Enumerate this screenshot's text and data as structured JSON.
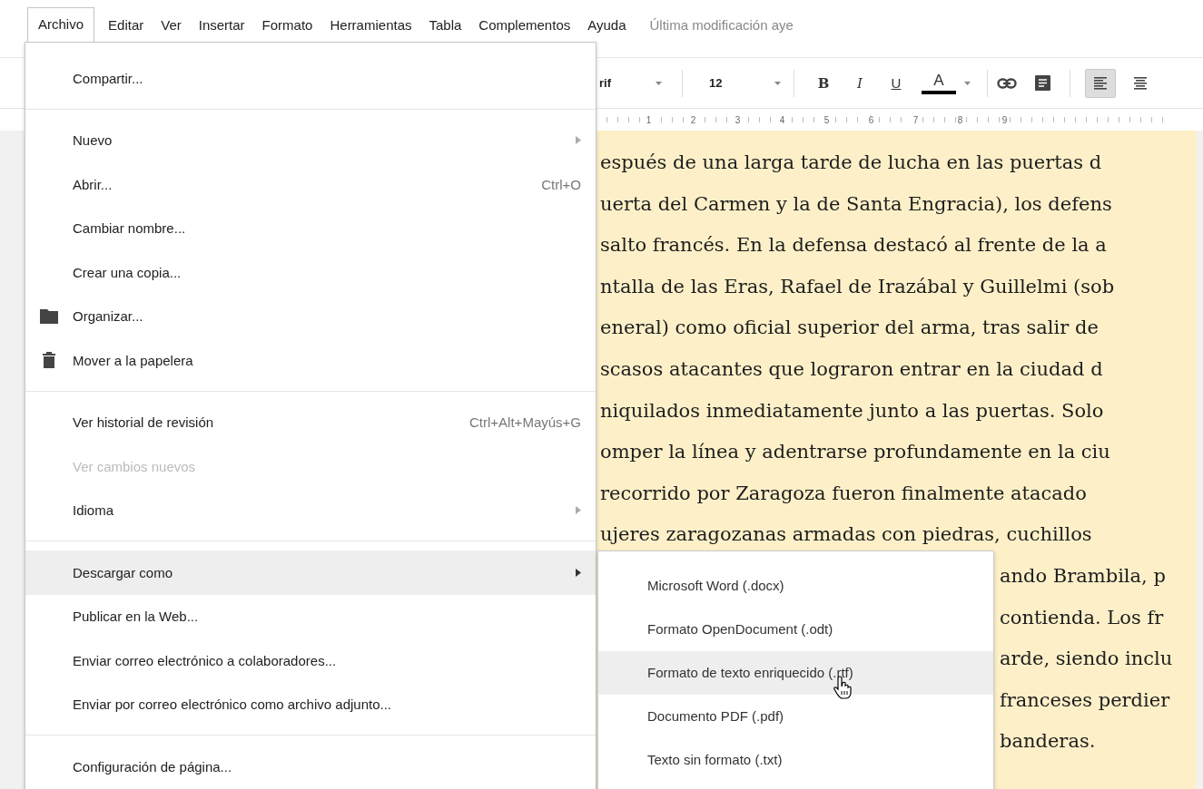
{
  "menubar": {
    "items": [
      {
        "label": "Archivo",
        "selected": true
      },
      {
        "label": "Editar",
        "selected": false
      },
      {
        "label": "Ver",
        "selected": false
      },
      {
        "label": "Insertar",
        "selected": false
      },
      {
        "label": "Formato",
        "selected": false
      },
      {
        "label": "Herramientas",
        "selected": false
      },
      {
        "label": "Tabla",
        "selected": false
      },
      {
        "label": "Complementos",
        "selected": false
      },
      {
        "label": "Ayuda",
        "selected": false
      }
    ],
    "last_modified": "Última modificación aye"
  },
  "toolbar": {
    "font_name": "rif",
    "font_size": "12",
    "format_buttons": [
      {
        "kind": "bold",
        "label": "B"
      },
      {
        "kind": "italic",
        "label": "I"
      },
      {
        "kind": "underline",
        "label": "U"
      },
      {
        "kind": "color",
        "label": "A"
      }
    ],
    "align_buttons": [
      {
        "kind": "left",
        "selected": true
      },
      {
        "kind": "center",
        "selected": false
      }
    ]
  },
  "ruler": {
    "numbers": [
      "1",
      "2",
      "3",
      "4",
      "5",
      "6",
      "7",
      "8",
      "9"
    ]
  },
  "document": {
    "lines": [
      "espués de una larga tarde de lucha en las puertas d",
      "uerta del Carmen y la de Santa Engracia), los defens",
      "salto francés. En la defensa destacó al frente de la a",
      "ntalla de las Eras, Rafael de Irazábal y Guillelmi (sob",
      "eneral) como oficial superior del arma, tras salir de",
      "scasos atacantes que lograron entrar en la ciudad d",
      "niquilados inmediatamente junto a las puertas. Solo",
      "omper la línea y adentrarse profundamente en la ciu",
      "recorrido por Zaragoza fueron finalmente atacado",
      "ujeres zaragozanas armadas con piedras, cuchillos",
      "ando Brambila, p",
      "contienda. Los fr",
      "arde, siendo inclu",
      "franceses perdier",
      "banderas."
    ]
  },
  "file_menu": {
    "items": [
      {
        "kind": "item",
        "label": "Compartir...",
        "selected": false,
        "disabled": false
      },
      {
        "kind": "separator"
      },
      {
        "kind": "item",
        "label": "Nuevo",
        "has_submenu": true,
        "selected": false,
        "disabled": false
      },
      {
        "kind": "item",
        "label": "Abrir...",
        "shortcut": "Ctrl+O",
        "selected": false,
        "disabled": false
      },
      {
        "kind": "item",
        "label": "Cambiar nombre...",
        "selected": false,
        "disabled": false
      },
      {
        "kind": "item",
        "label": "Crear una copia...",
        "selected": false,
        "disabled": false
      },
      {
        "kind": "folder-item",
        "label": "Organizar...",
        "selected": false,
        "disabled": false
      },
      {
        "kind": "trash-item",
        "label": "Mover a la papelera",
        "selected": false,
        "disabled": false
      },
      {
        "kind": "separator"
      },
      {
        "kind": "item",
        "label": "Ver historial de revisión",
        "shortcut": "Ctrl+Alt+Mayús+G",
        "selected": false,
        "disabled": false
      },
      {
        "kind": "item",
        "label": "Ver cambios nuevos",
        "selected": false,
        "disabled": true
      },
      {
        "kind": "item",
        "label": "Idioma",
        "has_submenu": true,
        "selected": false,
        "disabled": false
      },
      {
        "kind": "separator"
      },
      {
        "kind": "item",
        "label": "Descargar como",
        "has_submenu": true,
        "selected": true,
        "disabled": false
      },
      {
        "kind": "item",
        "label": "Publicar en la Web...",
        "selected": false,
        "disabled": false
      },
      {
        "kind": "item",
        "label": "Enviar correo electrónico a colaboradores...",
        "selected": false,
        "disabled": false
      },
      {
        "kind": "item",
        "label": "Enviar por correo electrónico como archivo adjunto...",
        "selected": false,
        "disabled": false
      },
      {
        "kind": "separator"
      },
      {
        "kind": "item",
        "label": "Configuración de página...",
        "selected": false,
        "disabled": false
      }
    ]
  },
  "download_submenu": {
    "items": [
      {
        "label": "Microsoft Word (.docx)",
        "selected": false
      },
      {
        "label": "Formato OpenDocument (.odt)",
        "selected": false
      },
      {
        "label": "Formato de texto enriquecido (.rtf)",
        "selected": true
      },
      {
        "label": "Documento PDF (.pdf)",
        "selected": false
      },
      {
        "label": "Texto sin formato (.txt)",
        "selected": false
      }
    ]
  }
}
